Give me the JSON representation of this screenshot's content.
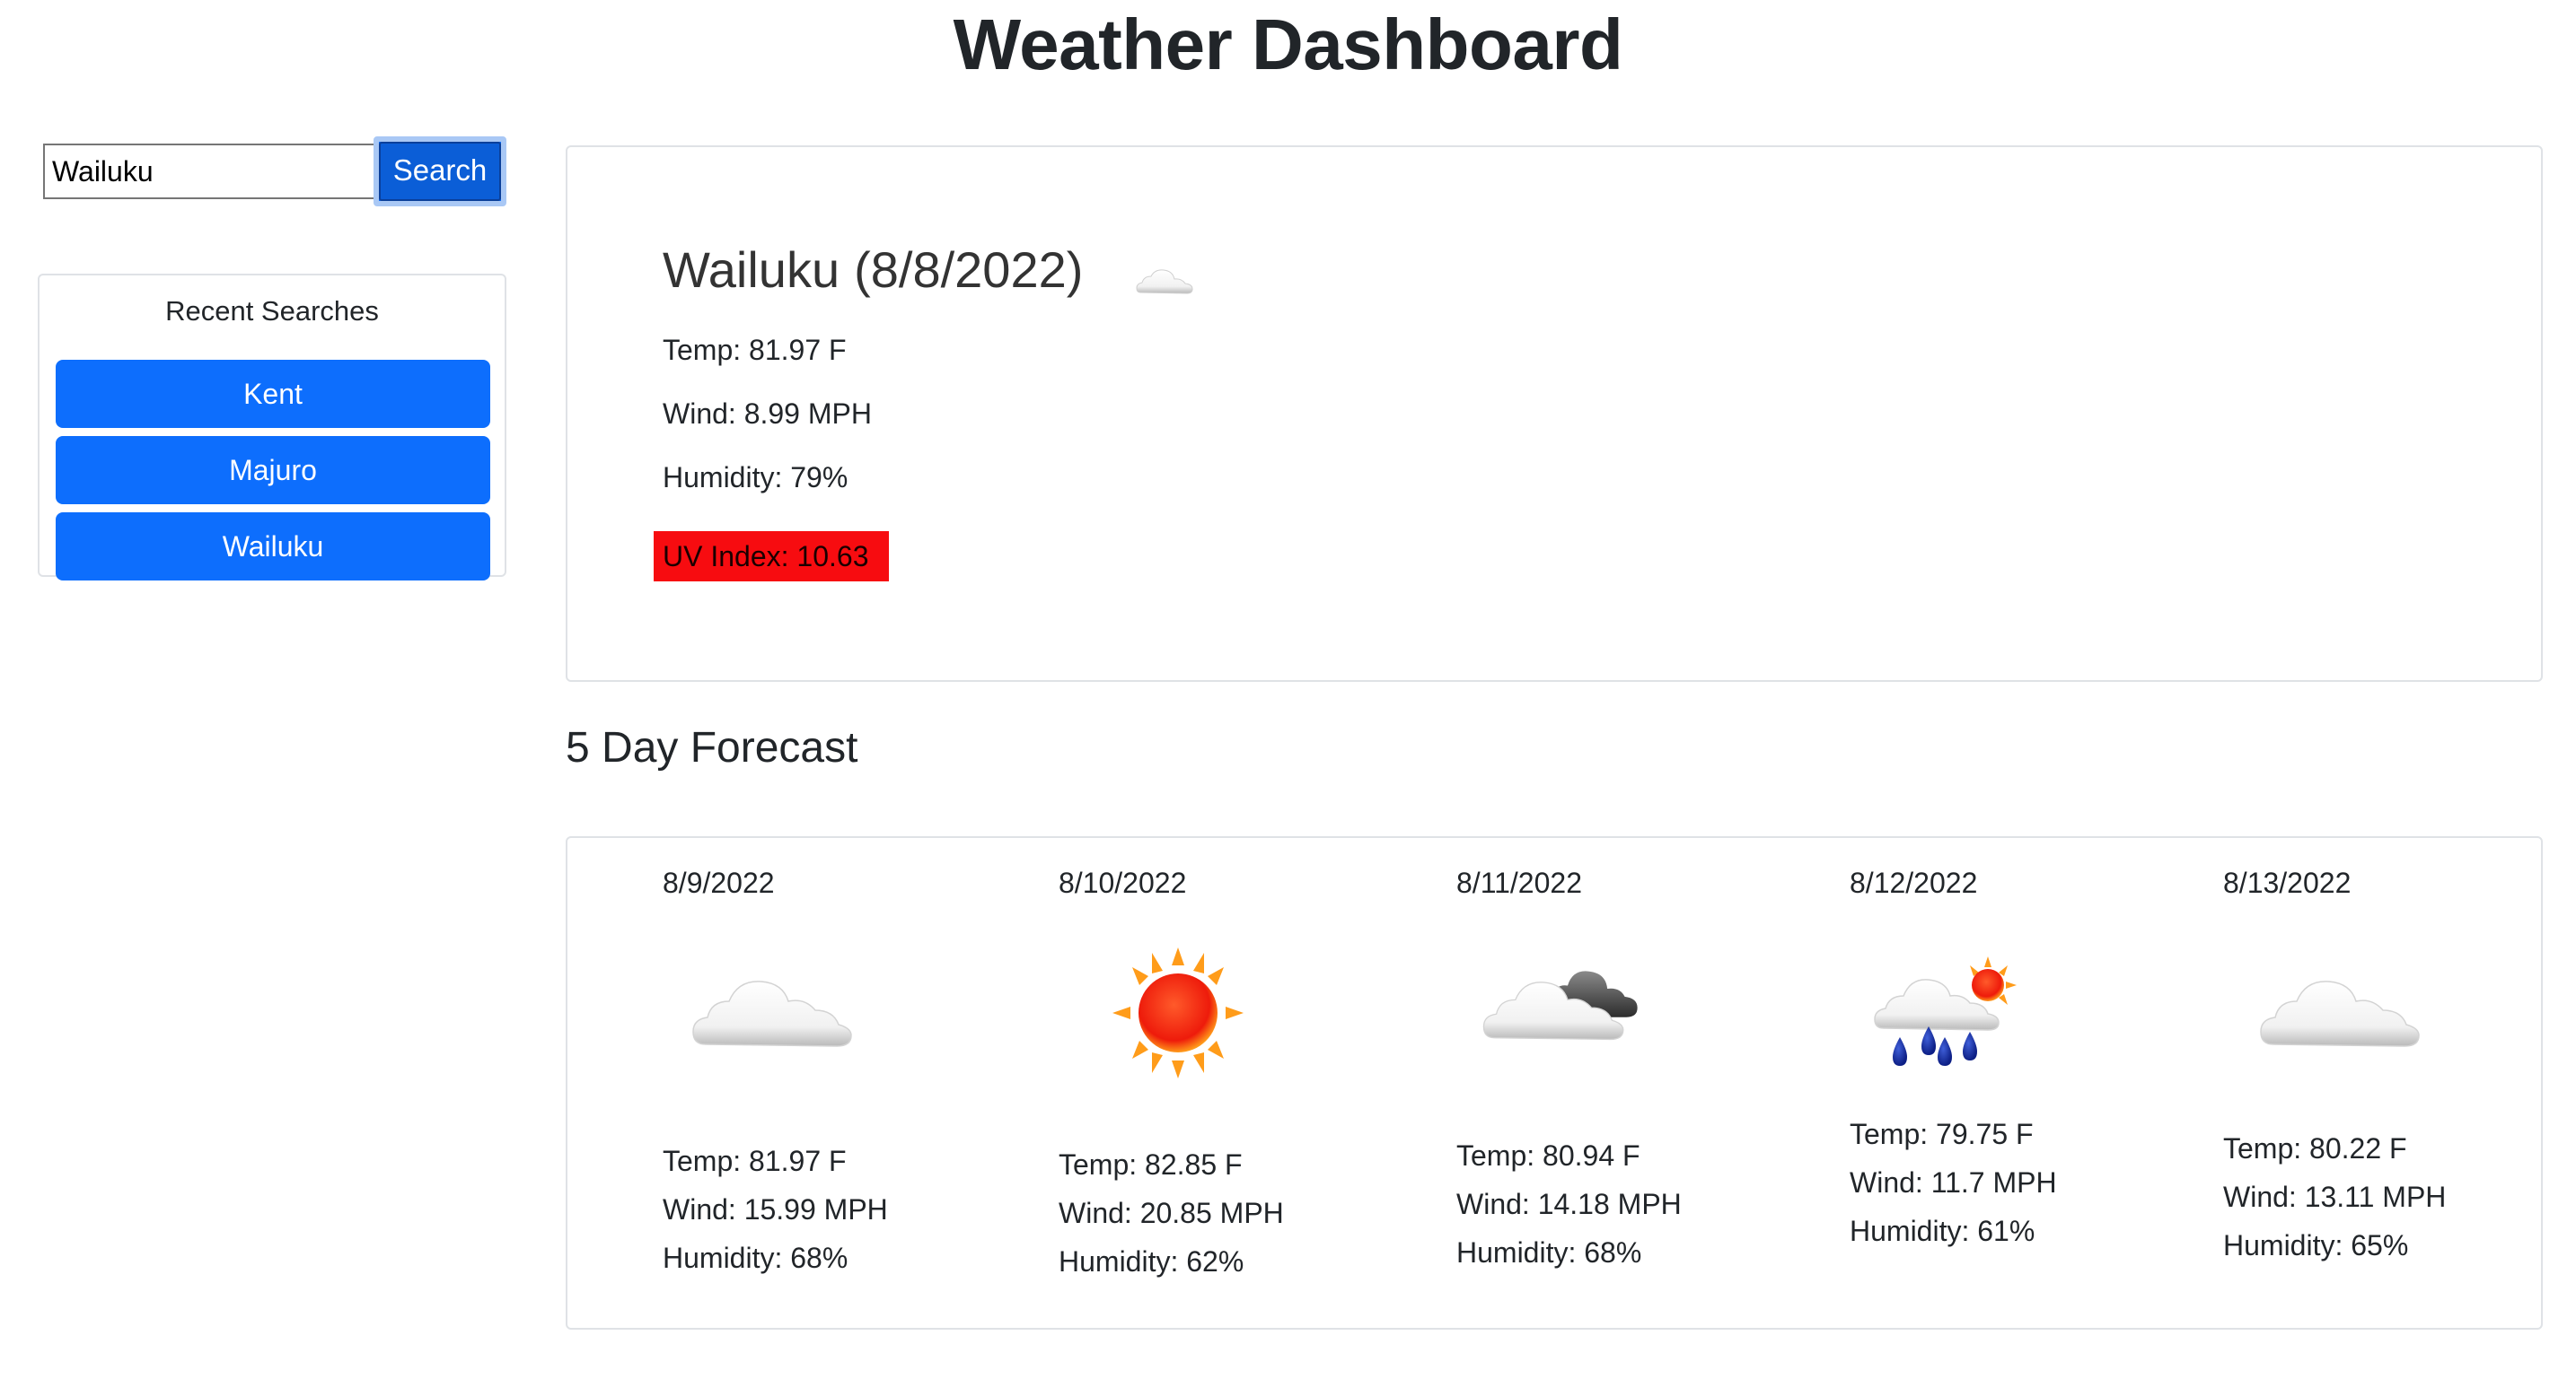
{
  "header": {
    "title": "Weather Dashboard"
  },
  "search": {
    "value": "Wailuku",
    "button_label": "Search"
  },
  "recent": {
    "title": "Recent Searches",
    "items": [
      {
        "label": "Kent"
      },
      {
        "label": "Majuro"
      },
      {
        "label": "Wailuku"
      }
    ]
  },
  "current": {
    "city": "Wailuku",
    "date": "(8/8/2022)",
    "icon": "cloud-icon",
    "temp": "Temp: 81.97 F",
    "wind": "Wind: 8.99 MPH",
    "humidity": "Humidity: 79%",
    "uv": "UV Index: 10.63",
    "uv_color": "#f70c10"
  },
  "forecast": {
    "title": "5 Day Forecast",
    "days": [
      {
        "date": "8/9/2022",
        "icon": "cloud-icon",
        "temp": "Temp: 81.97 F",
        "wind": "Wind: 15.99 MPH",
        "humidity": "Humidity: 68%"
      },
      {
        "date": "8/10/2022",
        "icon": "sun-icon",
        "temp": "Temp: 82.85 F",
        "wind": "Wind: 20.85 MPH",
        "humidity": "Humidity: 62%"
      },
      {
        "date": "8/11/2022",
        "icon": "broken-clouds-icon",
        "temp": "Temp: 80.94 F",
        "wind": "Wind: 14.18 MPH",
        "humidity": "Humidity: 68%"
      },
      {
        "date": "8/12/2022",
        "icon": "rain-sun-icon",
        "temp": "Temp: 79.75 F",
        "wind": "Wind: 11.7 MPH",
        "humidity": "Humidity: 61%"
      },
      {
        "date": "8/13/2022",
        "icon": "cloud-icon",
        "temp": "Temp: 80.22 F",
        "wind": "Wind: 13.11 MPH",
        "humidity": "Humidity: 65%"
      }
    ]
  },
  "colors": {
    "primary": "#0d6efd",
    "uv_high": "#f70c10",
    "card_border": "#dfe2e6"
  }
}
